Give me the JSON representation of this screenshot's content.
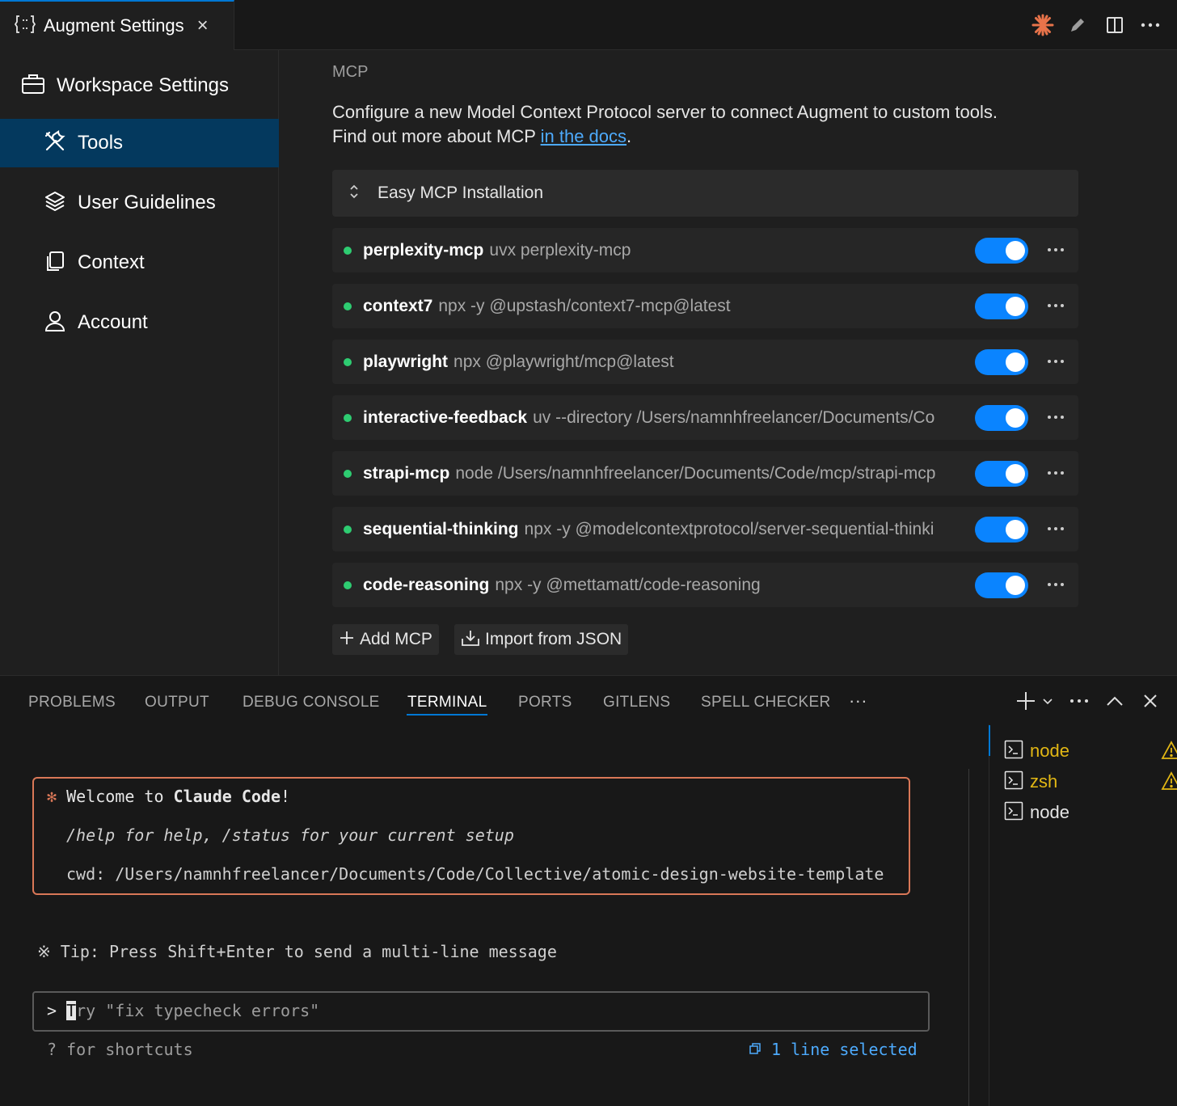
{
  "editor": {
    "tab_title": "Augment Settings",
    "close_glyph": "×"
  },
  "sidebar": {
    "header": "Workspace Settings",
    "items": [
      {
        "label": "Tools",
        "icon": "tools-icon",
        "active": true
      },
      {
        "label": "User Guidelines",
        "icon": "layers-icon",
        "active": false
      },
      {
        "label": "Context",
        "icon": "copy-icon",
        "active": false
      },
      {
        "label": "Account",
        "icon": "person-icon",
        "active": false
      }
    ]
  },
  "main": {
    "section_title": "MCP",
    "description_line1": "Configure a new Model Context Protocol server to connect Augment to custom tools.",
    "description_line2_prefix": "Find out more about MCP ",
    "docs_link": "in the docs",
    "description_line2_suffix": ".",
    "easy_install": "Easy MCP Installation",
    "servers": [
      {
        "name": "perplexity-mcp",
        "command": "uvx perplexity-mcp",
        "enabled": true
      },
      {
        "name": "context7",
        "command": "npx -y @upstash/context7-mcp@latest",
        "enabled": true
      },
      {
        "name": "playwright",
        "command": "npx @playwright/mcp@latest",
        "enabled": true
      },
      {
        "name": "interactive-feedback",
        "command": "uv --directory /Users/namnhfreelancer/Documents/Co",
        "enabled": true
      },
      {
        "name": "strapi-mcp",
        "command": "node /Users/namnhfreelancer/Documents/Code/mcp/strapi-mcp",
        "enabled": true
      },
      {
        "name": "sequential-thinking",
        "command": "npx -y @modelcontextprotocol/server-sequential-thinki",
        "enabled": true
      },
      {
        "name": "code-reasoning",
        "command": "npx -y @mettamatt/code-reasoning",
        "enabled": true
      }
    ],
    "add_button": "Add MCP",
    "import_button": "Import from JSON"
  },
  "panel": {
    "tabs": [
      "PROBLEMS",
      "OUTPUT",
      "DEBUG CONSOLE",
      "TERMINAL",
      "PORTS",
      "GITLENS",
      "SPELL CHECKER"
    ],
    "active_tab": "TERMINAL",
    "overflow": "···"
  },
  "terminal": {
    "welcome_star": "✻",
    "welcome_prefix": " Welcome to ",
    "welcome_bold": "Claude Code",
    "welcome_suffix": "!",
    "help_line": "/help for help, /status for your current setup",
    "cwd_line": "cwd: /Users/namnhfreelancer/Documents/Code/Collective/atomic-design-website-template",
    "tip_line": "※ Tip: Press Shift+Enter to send a multi-line message",
    "prompt": ">",
    "input_cursor_char": "T",
    "input_placeholder": "ry \"fix typecheck errors\"",
    "shortcuts_hint": "? for shortcuts",
    "selection_status": "1 line selected",
    "sessions": [
      {
        "label": "node",
        "warning": true
      },
      {
        "label": "zsh",
        "warning": true
      },
      {
        "label": "node",
        "warning": false
      }
    ]
  },
  "colors": {
    "accent": "#0078d4",
    "toggle_on": "#0a84ff",
    "status_dot": "#2ecc71",
    "claude_orange": "#d97757",
    "warning": "#e2b714",
    "link": "#4daafc"
  }
}
